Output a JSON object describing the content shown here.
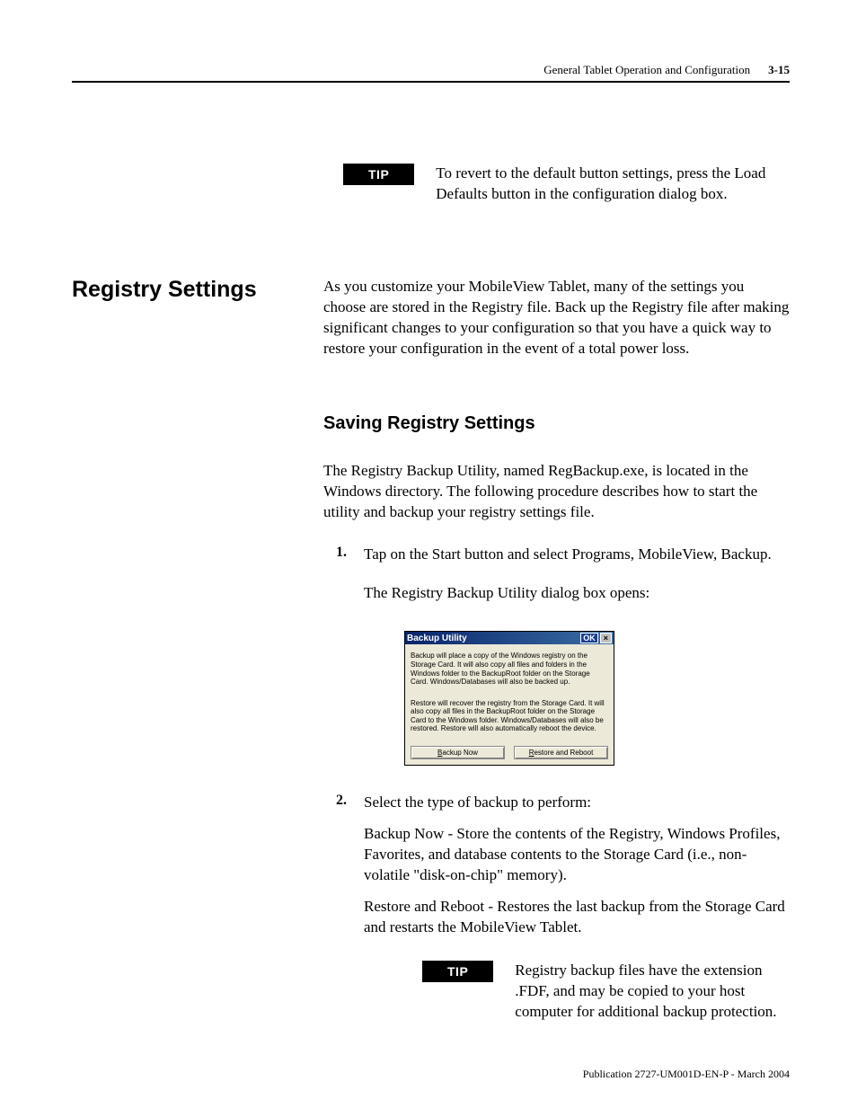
{
  "header": {
    "chapter": "General Tablet Operation and Configuration",
    "page": "3-15"
  },
  "tip1": {
    "label": "TIP",
    "text": "To revert to the default button settings, press the Load Defaults button in the configuration dialog box."
  },
  "section": {
    "title": "Registry Settings",
    "intro": "As you customize your MobileView Tablet, many of the settings you choose are stored in the Registry file. Back up the Registry file after making significant changes to your configuration so that you have a quick way to restore your configuration in the event of a total power loss."
  },
  "sub": {
    "title": "Saving Registry Settings",
    "intro": "The Registry Backup Utility, named RegBackup.exe, is located in the Windows directory. The following procedure describes how to start the utility and backup your registry settings file."
  },
  "steps": {
    "s1": {
      "num": "1.",
      "text": "Tap on the Start button and select Programs, MobileView, Backup.",
      "after": "The Registry Backup Utility dialog box opens:"
    },
    "s2": {
      "num": "2.",
      "text": "Select the type of backup to perform:",
      "p1": "Backup Now - Store the contents of the Registry, Windows Profiles, Favorites, and database contents to the Storage Card (i.e., non-volatile \"disk-on-chip\" memory).",
      "p2": "Restore and Reboot - Restores the last backup from the Storage Card and restarts the MobileView Tablet."
    }
  },
  "dialog": {
    "title": "Backup Utility",
    "ok": "OK",
    "close": "×",
    "p1": "Backup will place a copy of the Windows registry on the Storage Card.  It will also copy all files and folders in the Windows folder to the BackupRoot folder on the Storage Card.  Windows/Databases will also be backed up.",
    "p2": "Restore will recover the registry from the Storage Card. It will also copy all files in the BackupRoot folder on the Storage Card to the Windows folder.  Windows/Databases will also be restored.  Restore will also automatically reboot the device.",
    "btn1_u": "B",
    "btn1_rest": "ackup Now",
    "btn2_u": "R",
    "btn2_rest": "estore and Reboot"
  },
  "tip2": {
    "label": "TIP",
    "text": "Registry backup files have the extension .FDF, and may be copied to your host computer for additional backup protection."
  },
  "footer": {
    "text": "Publication 2727-UM001D-EN-P - March 2004"
  }
}
